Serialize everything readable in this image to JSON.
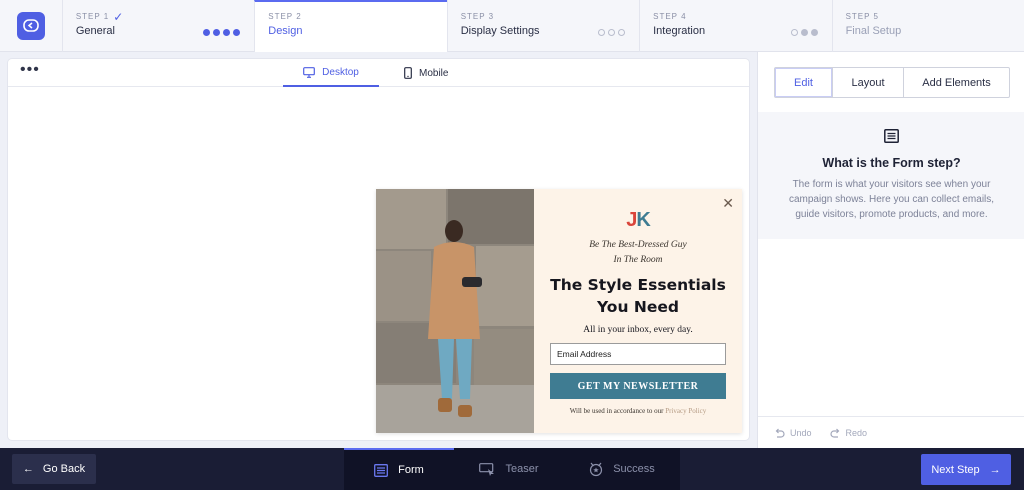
{
  "stepper": {
    "steps": [
      {
        "num": "STEP 1",
        "name": "General",
        "state": "done"
      },
      {
        "num": "STEP 2",
        "name": "Design",
        "state": "active"
      },
      {
        "num": "STEP 3",
        "name": "Display Settings",
        "state": "todo"
      },
      {
        "num": "STEP 4",
        "name": "Integration",
        "state": "todo"
      },
      {
        "num": "STEP 5",
        "name": "Final Setup",
        "state": "locked"
      }
    ]
  },
  "canvas": {
    "device_tabs": {
      "desktop": "Desktop",
      "mobile": "Mobile"
    }
  },
  "popup": {
    "brand_j": "J",
    "brand_k": "K",
    "kicker": "Be The Best-Dressed Guy\nIn The Room",
    "headline": "The Style Essentials\nYou Need",
    "subtext": "All in your inbox, every day.",
    "email_placeholder": "Email Address",
    "cta_label": "GET MY NEWSLETTER",
    "fine_print_prefix": "Will be used in accordance to our",
    "privacy_link": "Privacy Policy"
  },
  "panel": {
    "tabs": {
      "edit": "Edit",
      "layout": "Layout",
      "add": "Add Elements"
    },
    "info_title": "What is the Form step?",
    "info_body": "The form is what your visitors see when your campaign shows. Here you can collect emails, guide visitors, promote products, and more.",
    "undo": "Undo",
    "redo": "Redo"
  },
  "bottom": {
    "go_back": "Go Back",
    "modes": {
      "form": "Form",
      "teaser": "Teaser",
      "success": "Success"
    },
    "next_step": "Next Step"
  },
  "colors": {
    "accent": "#4f5fe3",
    "popup_bg": "#fdf3e8",
    "cta": "#3f7c92",
    "brand_red": "#d9453b",
    "bottom_bar": "#1a1d35"
  }
}
